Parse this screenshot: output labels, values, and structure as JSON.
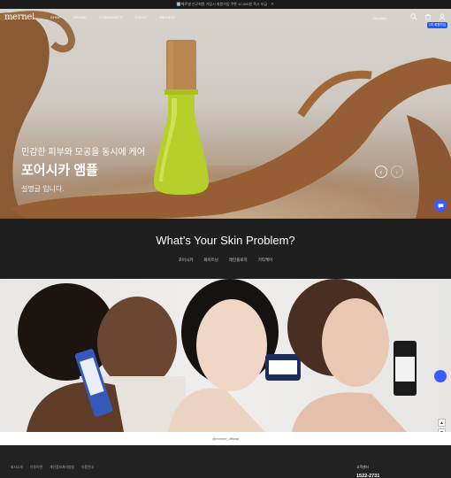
{
  "topbar": {
    "message": "ℹ️메르넬 신규회원 가입시 회원가입 쿠폰 10,000원 즉시 지급",
    "close": "✕"
  },
  "header": {
    "logo": "mernel",
    "nav": [
      "SHOP",
      "BRAND",
      "COMMUNITY",
      "EVENT",
      "REVIEW"
    ],
    "lang": "GLOBAL",
    "badge": "1초 회원가입"
  },
  "hero": {
    "subtitle": "민감한 피부와 모공을 동시에 케어",
    "title": "포어시카 앰플",
    "description": "설명글 입니다."
  },
  "skin": {
    "heading": "What’s Your Skin Problem?",
    "tabs": [
      "포어시카",
      "화이트닝",
      "레틴올로지",
      "기타케어"
    ]
  },
  "instagram": {
    "handle": "@mernel_official"
  },
  "footer": {
    "links": [
      "회사소개",
      "이용약관",
      "개인정보처리방침",
      "이용안내"
    ],
    "cs_label": "고객센터",
    "cs_phone": "1522-2731"
  },
  "colors": {
    "accent": "#3a5bff",
    "dark": "#1f1f1f",
    "bottle_green": "#b6cf2a"
  }
}
